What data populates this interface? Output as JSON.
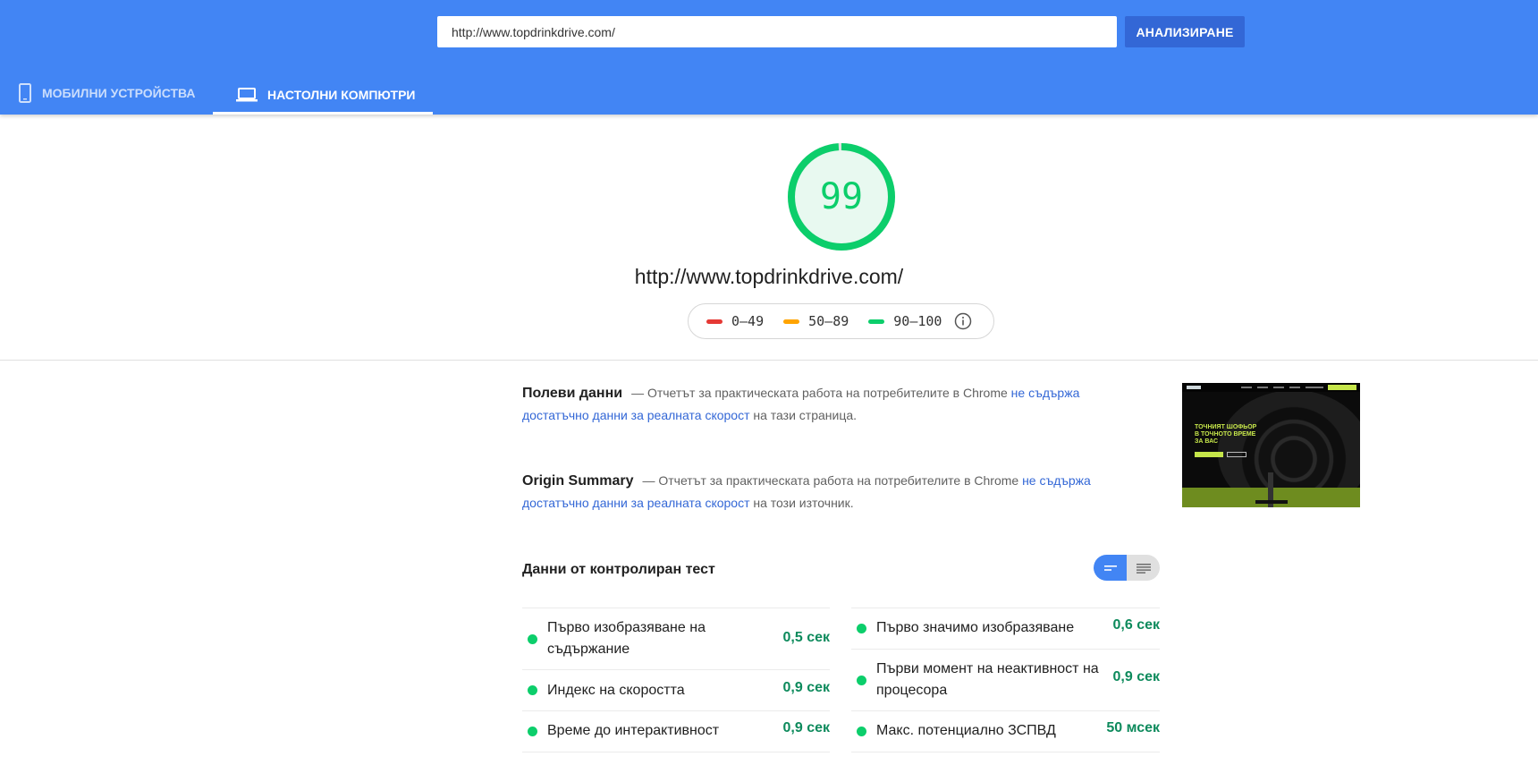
{
  "header": {
    "url_value": "http://www.topdrinkdrive.com/",
    "analyze_label": "АНАЛИЗИРАНЕ",
    "accent_color": "#4285f4"
  },
  "tabs": [
    {
      "label": "МОБИЛНИ УСТРОЙСТВА",
      "icon": "phone-icon",
      "active": false
    },
    {
      "label": "НАСТОЛНИ КОМПЮТРИ",
      "icon": "laptop-icon",
      "active": true
    }
  ],
  "summary": {
    "score": "99",
    "score_fraction": 0.99,
    "score_color": "#0cce6b",
    "url": "http://www.topdrinkdrive.com/"
  },
  "legend": [
    {
      "range": "0–49",
      "color": "#e53935"
    },
    {
      "range": "50–89",
      "color": "#ffa400"
    },
    {
      "range": "90–100",
      "color": "#0cce6b"
    }
  ],
  "field_data": {
    "title": "Полеви данни",
    "text_before": "— Отчетът за практическата работа на потребителите в Chrome ",
    "link": "не съдържа достатъчно данни за реалната скорост",
    "text_after": " на тази страница."
  },
  "origin_summary": {
    "title": "Origin Summary",
    "text_before": "— Отчетът за практическата работа на потребителите в Chrome ",
    "link": "не съдържа достатъчно данни за реалната скорост",
    "text_after": " на този източник."
  },
  "thumbnail": {
    "headline": "ТОЧНИЯТ ШОФЬОР В ТОЧНОТО ВРЕМЕ ЗА ВАС"
  },
  "lab_data": {
    "title": "Данни от контролиран тест",
    "metrics_left": [
      {
        "label": "Първо изобразяване на съдържание",
        "value": "0,5 сек"
      },
      {
        "label": "Индекс на скоростта",
        "value": "0,9 сек"
      },
      {
        "label": "Време до интерактивност",
        "value": "0,9 сек"
      }
    ],
    "metrics_right": [
      {
        "label": "Първо значимо изобразяване",
        "value": "0,6 сек"
      },
      {
        "label": "Първи момент на неактивност на процесора",
        "value": "0,9 сек"
      },
      {
        "label": "Макс. потенциално ЗСПВД",
        "value": "50 мсек"
      }
    ]
  }
}
